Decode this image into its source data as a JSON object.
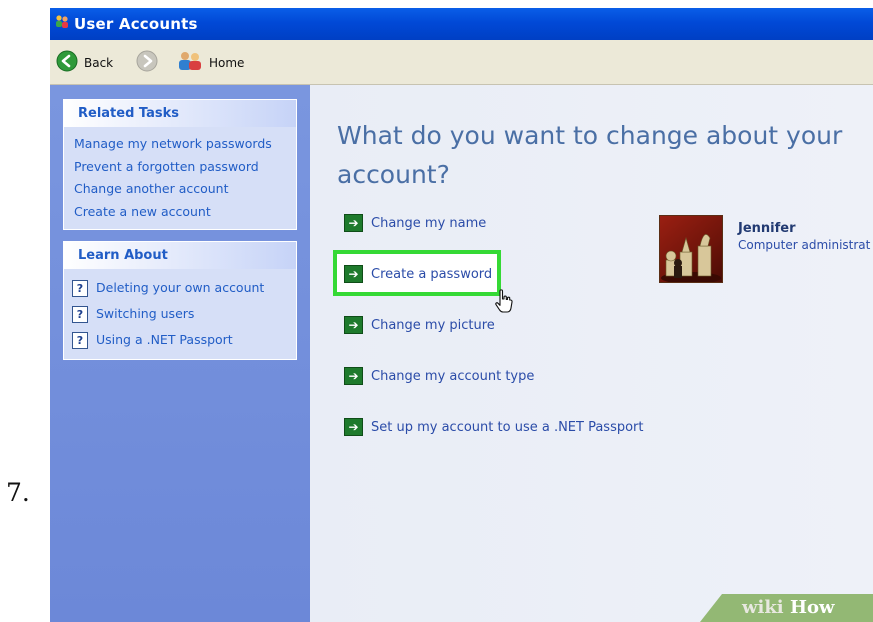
{
  "step": {
    "number": "7."
  },
  "window": {
    "title": "User Accounts",
    "toolbar": {
      "back_label": "Back",
      "home_label": "Home"
    }
  },
  "sidebar": {
    "related_tasks": {
      "header": "Related Tasks",
      "items": [
        "Manage my network passwords",
        "Prevent a forgotten password",
        "Change another account",
        "Create a new account"
      ]
    },
    "learn_about": {
      "header": "Learn About",
      "items": [
        "Deleting your own account",
        "Switching users",
        "Using a .NET Passport"
      ]
    }
  },
  "main": {
    "headline_line1": "What do you want to change about your",
    "headline_line2": "account?",
    "actions": [
      "Change my name",
      "Create a password",
      "Change my picture",
      "Change my account type",
      "Set up my account to use a .NET Passport"
    ],
    "highlighted_action": "Create a password",
    "user": {
      "name": "Jennifer",
      "role": "Computer administrat"
    }
  },
  "watermark": {
    "text_part1": "wiki",
    "text_part2": "How"
  },
  "colors": {
    "titlebar": "#0149d6",
    "sidebar": "#6c88d8",
    "link": "#215dc6",
    "headline": "#4a6fa5",
    "highlight": "#35d935",
    "arrow": "#1e7a2c"
  },
  "icons": [
    "user-accounts-icon",
    "back-arrow-icon",
    "forward-arrow-icon",
    "home-users-icon",
    "help-icon",
    "green-arrow-icon",
    "mouse-cursor-icon"
  ]
}
